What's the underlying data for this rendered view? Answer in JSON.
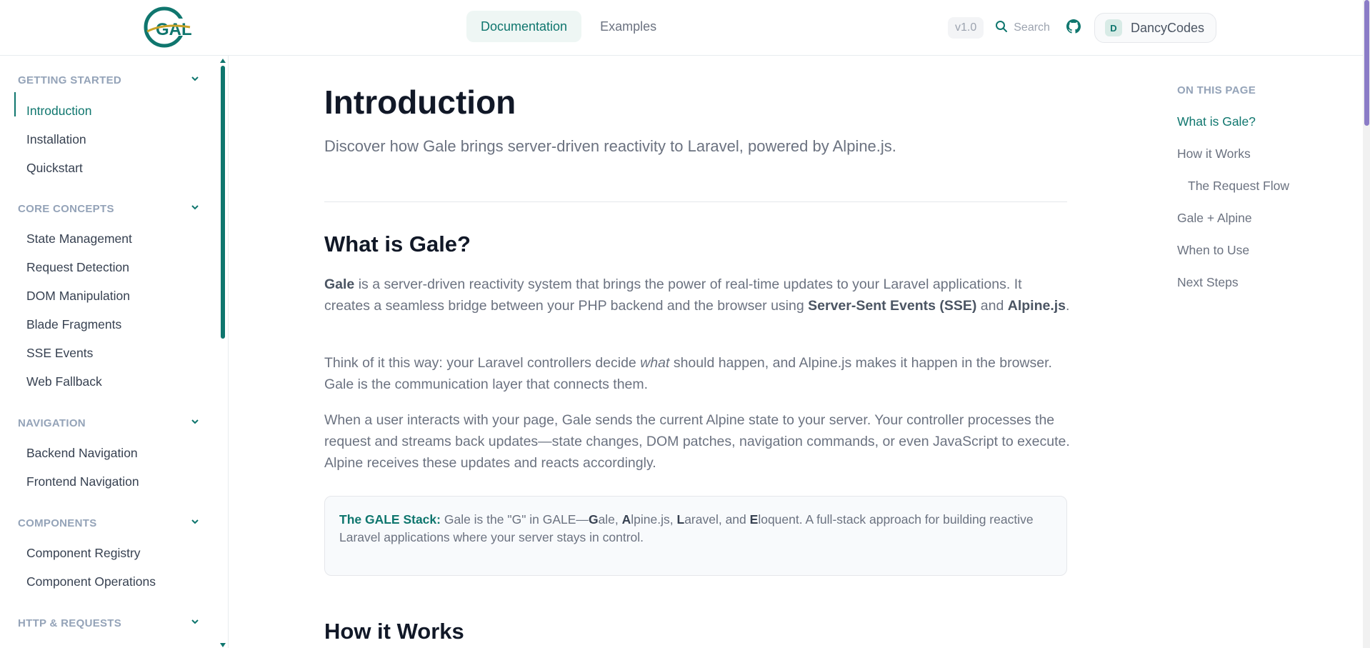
{
  "header": {
    "logo_text": "GALE",
    "tabs": [
      {
        "label": "Documentation",
        "active": true
      },
      {
        "label": "Examples",
        "active": false
      }
    ],
    "version": "v1.0",
    "search_label": "Search",
    "user": {
      "initial": "D",
      "name": "DancyCodes"
    }
  },
  "sidebar": {
    "sections": [
      {
        "title": "GETTING STARTED",
        "items": [
          "Introduction",
          "Installation",
          "Quickstart"
        ]
      },
      {
        "title": "CORE CONCEPTS",
        "items": [
          "State Management",
          "Request Detection",
          "DOM Manipulation",
          "Blade Fragments",
          "SSE Events",
          "Web Fallback"
        ]
      },
      {
        "title": "NAVIGATION",
        "items": [
          "Backend Navigation",
          "Frontend Navigation"
        ]
      },
      {
        "title": "COMPONENTS",
        "items": [
          "Component Registry",
          "Component Operations"
        ]
      },
      {
        "title": "HTTP & REQUESTS",
        "items": []
      }
    ],
    "active_item": "Introduction"
  },
  "main": {
    "title": "Introduction",
    "lead": "Discover how Gale brings server-driven reactivity to Laravel, powered by Alpine.js.",
    "section1_title": "What is Gale?",
    "p1": {
      "gale": "Gale",
      "t1": " is a server-driven reactivity system that brings the power of real-time updates to your Laravel applications. It creates a seamless bridge between your PHP backend and the browser using ",
      "sse": "Server-Sent Events (SSE)",
      "and": " and ",
      "alpine": "Alpine.js",
      "end": "."
    },
    "p2": {
      "t1": "Think of it this way: your Laravel controllers decide ",
      "what": "what",
      "t2": " should happen, and Alpine.js makes it happen in the browser. Gale is the communication layer that connects them."
    },
    "p3": "When a user interacts with your page, Gale sends the current Alpine state to your server. Your controller processes the request and streams back updates—state changes, DOM patches, navigation commands, or even JavaScript to execute. Alpine receives these updates and reacts accordingly.",
    "callout": {
      "label": "The GALE Stack:",
      "t1": " Gale is the \"G\" in GALE—",
      "g": "G",
      "g_rest": "ale, ",
      "a": "A",
      "a_rest": "lpine.js, ",
      "l": "L",
      "l_rest": "aravel, and ",
      "e": "E",
      "e_rest": "loquent. A full-stack approach for building reactive Laravel applications where your server stays in control."
    },
    "section2_title": "How it Works"
  },
  "toc": {
    "title": "ON THIS PAGE",
    "items": [
      {
        "label": "What is Gale?",
        "active": true,
        "sub": false
      },
      {
        "label": "How it Works",
        "active": false,
        "sub": false
      },
      {
        "label": "The Request Flow",
        "active": false,
        "sub": true
      },
      {
        "label": "Gale + Alpine",
        "active": false,
        "sub": false
      },
      {
        "label": "When to Use",
        "active": false,
        "sub": false
      },
      {
        "label": "Next Steps",
        "active": false,
        "sub": false
      }
    ]
  },
  "colors": {
    "accent": "#0f766e",
    "scrollbar_thumb": "#8b7cc7"
  }
}
